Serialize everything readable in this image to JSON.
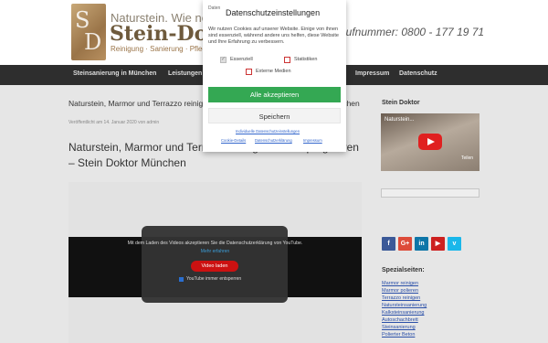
{
  "header": {
    "logo_letters": "SD",
    "logo_line1": "Naturstein. Wie neu",
    "logo_line2": "Stein-Doktor",
    "logo_line3": "Reinigung · Sanierung · Pflege",
    "phone": "Rufnummer: 0800 - 177 19 71"
  },
  "nav": {
    "items": [
      "Steinsanierung in München",
      "Leistungen",
      "Impressum",
      "Datenschutz"
    ]
  },
  "content": {
    "breadcrumb_title": "Naturstein, Marmor und Terrazzo reinigen und imprägnieren – Stein Doktor München",
    "meta": "Veröffentlicht am 14. Januar 2020 von admin",
    "h1": "Naturstein, Marmor und Terrazzo reinigen und imprägnieren – Stein Doktor München",
    "video": {
      "consent_text": "Mit dem Laden des Videos akzeptieren Sie die Datenschutzerklärung von YouTube.",
      "more_link": "Mehr erfahren",
      "load_button": "Video laden",
      "always_unblock": "YouTube immer entsperren"
    }
  },
  "sidebar": {
    "heading": "Stein Doktor",
    "yt_title": "Naturstein...",
    "yt_subtitle": "Teilen",
    "social": [
      {
        "icon": "facebook-icon",
        "label": "f",
        "color": "#3b5998"
      },
      {
        "icon": "google-plus-icon",
        "label": "G+",
        "color": "#dd4b39"
      },
      {
        "icon": "linkedin-icon",
        "label": "in",
        "color": "#0e76a8"
      },
      {
        "icon": "youtube-icon",
        "label": "▶",
        "color": "#cd201f"
      },
      {
        "icon": "vimeo-icon",
        "label": "v",
        "color": "#1ab7ea"
      }
    ],
    "special_heading": "Spezialseiten:",
    "special_links": [
      "Marmor reinigen",
      "Marmor polieren",
      "Terrazzo reinigen",
      "Natursteinsanierung",
      "Kalksteinsanierung",
      "Autoschachbrett",
      "Steinsanierung",
      "Polierter Beton",
      "Natursteinsanierung"
    ]
  },
  "cookie_dialog": {
    "logo_alt": "Daten",
    "title": "Datenschutzeinstellungen",
    "text": "Wir nutzen Cookies auf unserer Website. Einige von ihnen sind essenziell, während andere uns helfen, diese Website und Ihre Erfahrung zu verbessern.",
    "options": [
      {
        "label": "Essenziell",
        "checked": true
      },
      {
        "label": "Statistiken",
        "checked": false
      },
      {
        "label": "Externe Medien",
        "checked": false
      }
    ],
    "accept_all": "Alle akzeptieren",
    "save": "Speichern",
    "individual": "Individuelle Datenschutzeinstellungen",
    "footer_links": [
      "Cookie-Details",
      "Datenschutzerklärung",
      "Impressum"
    ]
  },
  "colors": {
    "accept": "#34a853",
    "nav_bg": "#2e2e2e"
  }
}
